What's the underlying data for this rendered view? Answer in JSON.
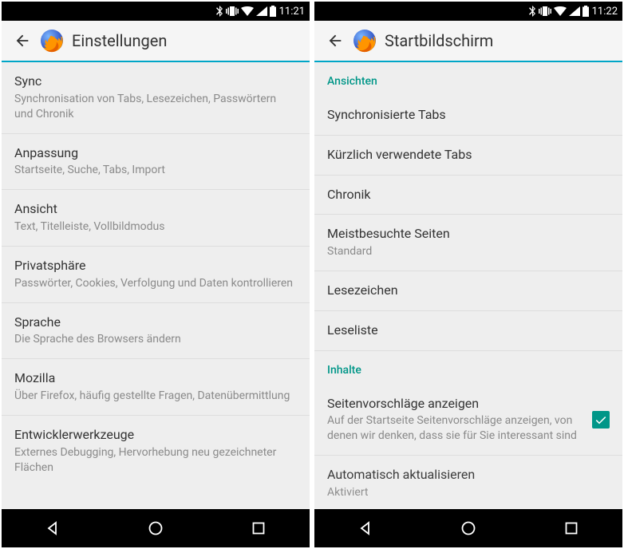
{
  "left": {
    "status_time": "11:21",
    "title": "Einstellungen",
    "items": [
      {
        "title": "Sync",
        "sub": "Synchronisation von Tabs, Lesezeichen, Passwörtern und Chronik"
      },
      {
        "title": "Anpassung",
        "sub": "Startseite, Suche, Tabs, Import"
      },
      {
        "title": "Ansicht",
        "sub": "Text, Titelleiste, Vollbildmodus"
      },
      {
        "title": "Privatsphäre",
        "sub": "Passwörter, Cookies, Verfolgung und Daten kontrollieren"
      },
      {
        "title": "Sprache",
        "sub": "Die Sprache des Browsers ändern"
      },
      {
        "title": "Mozilla",
        "sub": "Über Firefox, häufig gestellte Fragen, Datenübermittlung"
      },
      {
        "title": "Entwicklerwerkzeuge",
        "sub": "Externes Debugging, Hervorhebung neu gezeichneter Flächen"
      }
    ]
  },
  "right": {
    "status_time": "11:22",
    "title": "Startbildschirm",
    "section1": "Ansichten",
    "views": [
      {
        "title": "Synchronisierte Tabs"
      },
      {
        "title": "Kürzlich verwendete Tabs"
      },
      {
        "title": "Chronik"
      },
      {
        "title": "Meistbesuchte Seiten",
        "sub": "Standard"
      },
      {
        "title": "Lesezeichen"
      },
      {
        "title": "Leseliste"
      }
    ],
    "section2": "Inhalte",
    "content_items": [
      {
        "title": "Seitenvorschläge anzeigen",
        "sub": "Auf der Startseite Seitenvorschläge anzeigen, von denen wir denken, dass sie für Sie interessant sind",
        "checked": true
      },
      {
        "title": "Automatisch aktualisieren",
        "sub": "Aktiviert"
      }
    ]
  }
}
